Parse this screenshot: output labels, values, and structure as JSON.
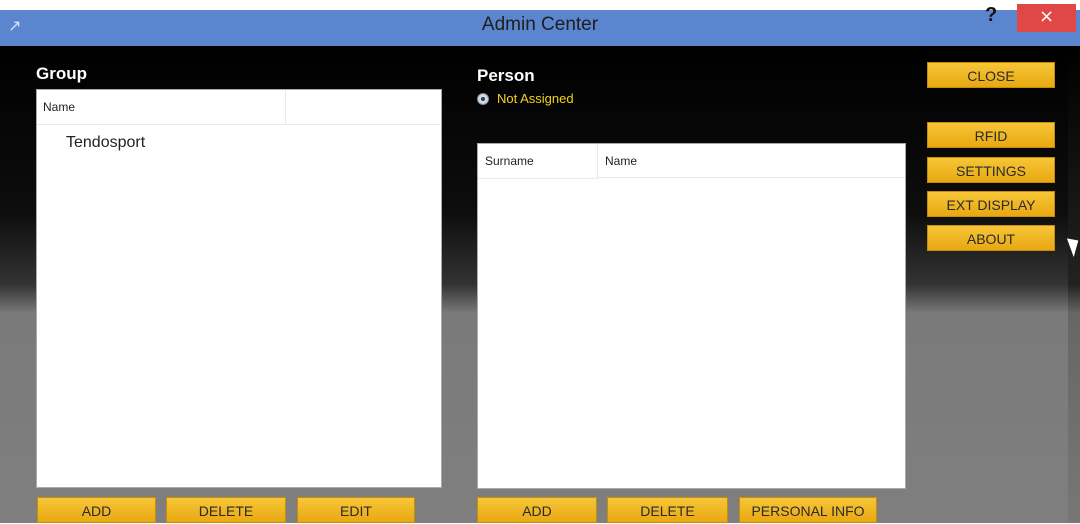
{
  "window": {
    "title": "Admin Center",
    "help_label": "?",
    "close_label": "×",
    "app_icon": "expand-arrow-icon"
  },
  "group": {
    "title": "Group",
    "column_name": "Name",
    "rows": [
      "Tendosport"
    ],
    "buttons": {
      "add": "ADD",
      "delete": "DELETE",
      "edit": "EDIT"
    }
  },
  "person": {
    "title": "Person",
    "radio_label": "Not Assigned",
    "columns": {
      "surname": "Surname",
      "name": "Name"
    },
    "rows": [],
    "buttons": {
      "add": "ADD",
      "delete": "DELETE",
      "personal_info": "PERSONAL INFO"
    }
  },
  "sidebar": {
    "close": "CLOSE",
    "rfid": "RFID",
    "settings": "SETTINGS",
    "ext_display": "EXT DISPLAY",
    "about": "ABOUT"
  },
  "colors": {
    "titlebar": "#5b86cf",
    "button": "#f2b827",
    "accent_text": "#f2d21a",
    "close": "#e04848"
  }
}
